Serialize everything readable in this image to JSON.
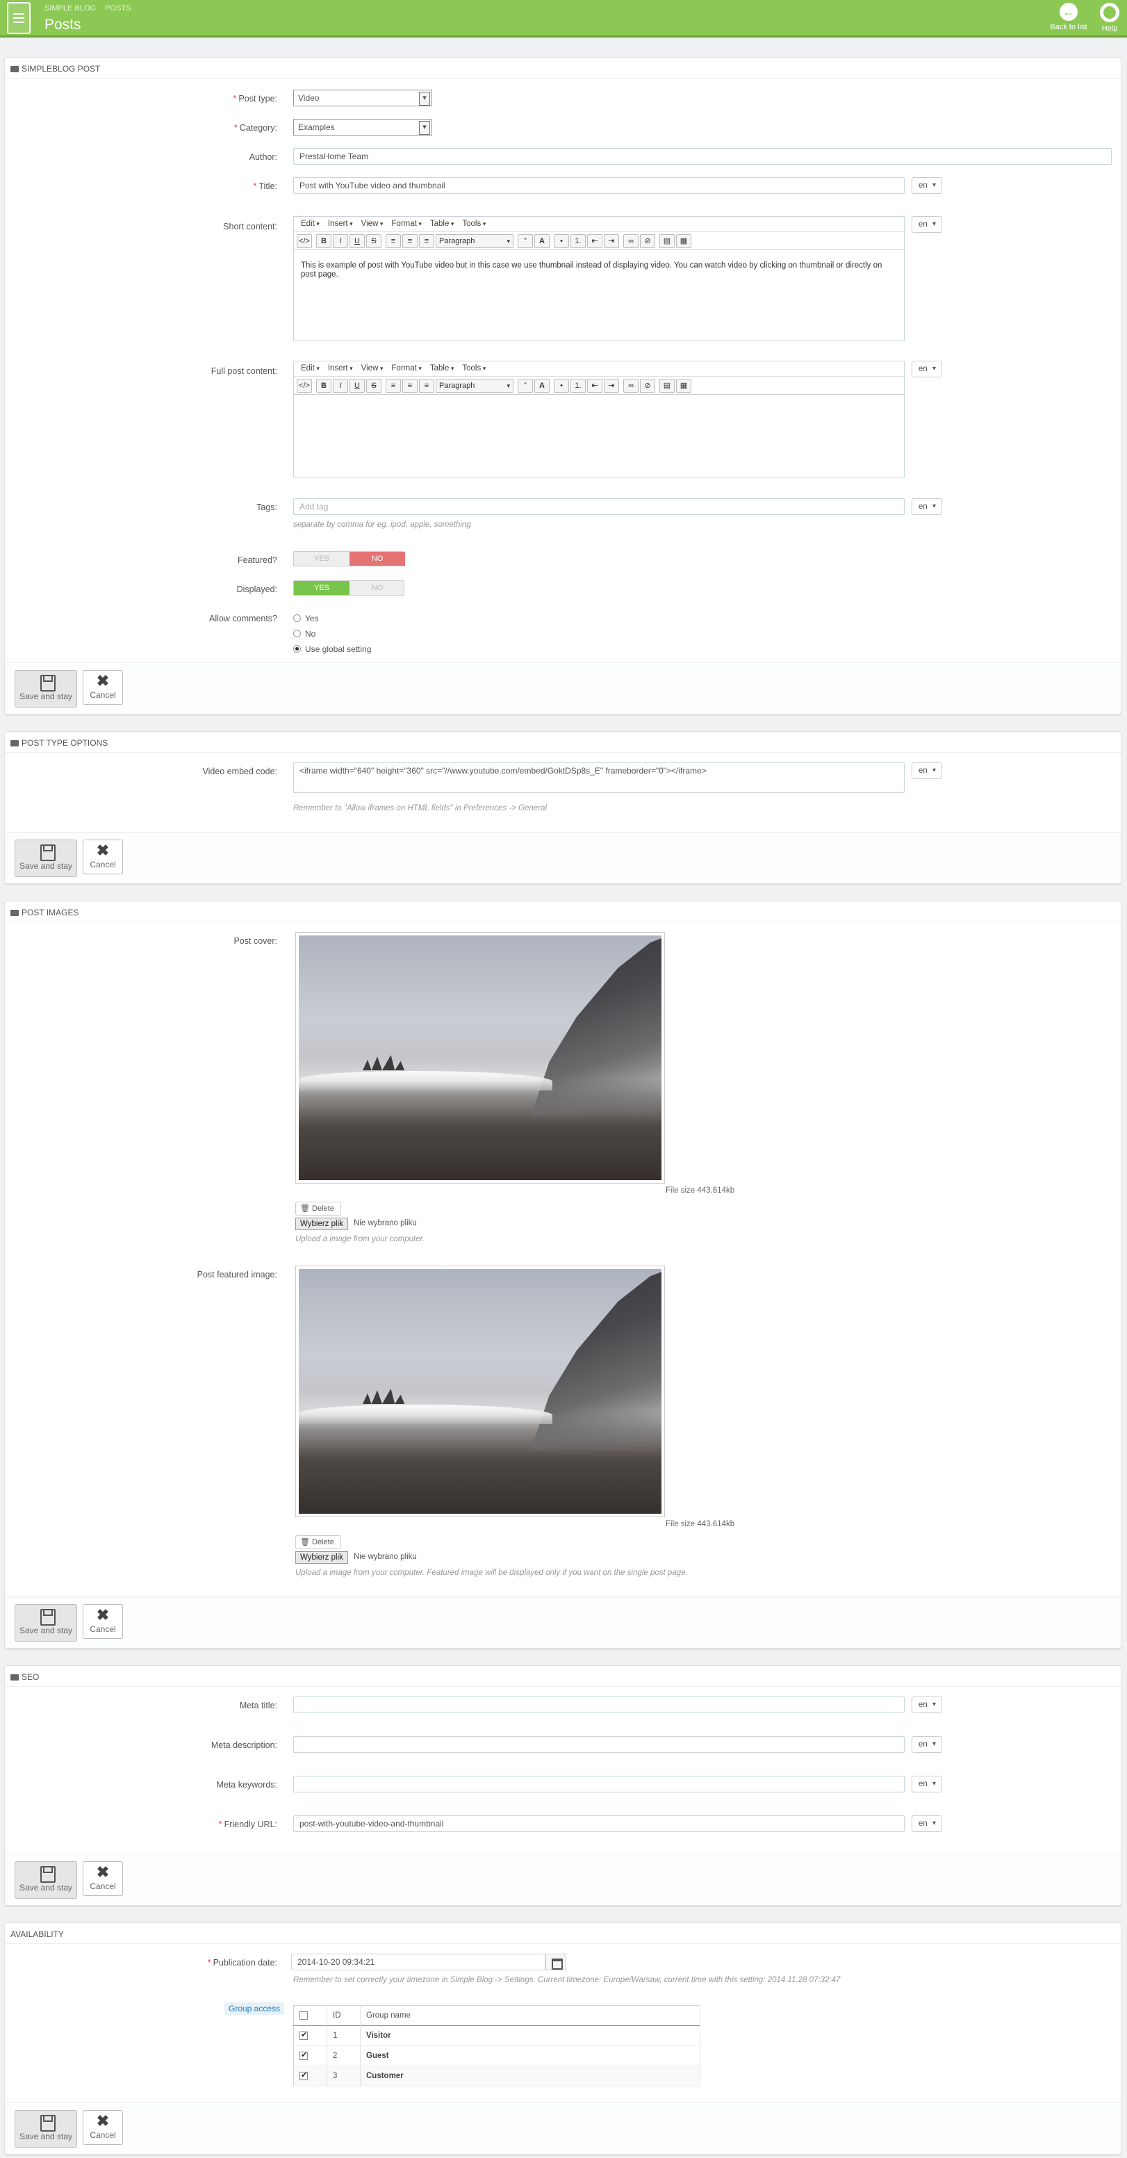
{
  "header": {
    "breadcrumb": [
      "SIMPLE BLOG",
      "POSTS"
    ],
    "title": "Posts",
    "back_label": "Back to list",
    "help_label": "Help"
  },
  "footer": {
    "save_label": "Save and stay",
    "cancel_label": "Cancel"
  },
  "post_panel": {
    "heading": "SIMPLEBLOG POST",
    "post_type": {
      "label": "Post type:",
      "value": "Video"
    },
    "category": {
      "label": "Category:",
      "value": "Examples"
    },
    "author": {
      "label": "Author:",
      "value": "PrestaHome Team"
    },
    "title": {
      "label": "Title:",
      "value": "Post with YouTube video and thumbnail",
      "lang": "en"
    },
    "editor_menu": [
      "Edit",
      "Insert",
      "View",
      "Format",
      "Table",
      "Tools"
    ],
    "editor_format": "Paragraph",
    "short_content": {
      "label": "Short content:",
      "lang": "en",
      "text": "This is example of post with YouTube video but in this case we use thumbnail instead of displaying video. You can watch video by clicking on thumbnail or directly on post page."
    },
    "full_content": {
      "label": "Full post content:",
      "lang": "en",
      "text": ""
    },
    "tags": {
      "label": "Tags:",
      "placeholder": "Add tag",
      "lang": "en",
      "hint": "separate by comma for eg. ipod, apple, something"
    },
    "featured": {
      "label": "Featured?",
      "yes": "YES",
      "no": "NO",
      "value": "no"
    },
    "displayed": {
      "label": "Displayed:",
      "yes": "YES",
      "no": "NO",
      "value": "yes"
    },
    "comments": {
      "label": "Allow comments?",
      "options": [
        "Yes",
        "No",
        "Use global setting"
      ],
      "selected": 2
    }
  },
  "type_panel": {
    "heading": "POST TYPE OPTIONS",
    "video": {
      "label": "Video embed code:",
      "value": "<iframe width=\"640\" height=\"360\" src=\"//www.youtube.com/embed/GoktDSp8s_E\" frameborder=\"0\"></iframe>",
      "lang": "en",
      "hint": "Remember to \"Allow iframes on HTML fields\" in Preferences -> General"
    }
  },
  "images_panel": {
    "heading": "POST IMAGES",
    "cover": {
      "label": "Post cover:",
      "filesize": "File size 443.614kb",
      "delete": "Delete",
      "choose": "Wybierz plik",
      "no_file": "Nie wybrano pliku",
      "hint": "Upload a image from your computer."
    },
    "featured_image": {
      "label": "Post featured image:",
      "filesize": "File size 443.614kb",
      "delete": "Delete",
      "choose": "Wybierz plik",
      "no_file": "Nie wybrano pliku",
      "hint": "Upload a image from your computer. Featured image will be displayed only if you want on the single post page."
    }
  },
  "seo_panel": {
    "heading": "SEO",
    "meta_title": {
      "label": "Meta title:",
      "value": "",
      "lang": "en"
    },
    "meta_description": {
      "label": "Meta description:",
      "value": "",
      "lang": "en"
    },
    "meta_keywords": {
      "label": "Meta keywords:",
      "value": "",
      "lang": "en"
    },
    "friendly_url": {
      "label": "Friendly URL:",
      "value": "post-with-youtube-video-and-thumbnail",
      "lang": "en"
    }
  },
  "availability_panel": {
    "heading": "AVAILABILITY",
    "publication": {
      "label": "Publication date:",
      "value": "2014-10-20 09:34:21",
      "hint": "Remember to set correctly your timezone in Simple Blog -> Settings. Current timezone: Europe/Warsaw, current time with this setting: 2014.11.28 07:32:47"
    },
    "group_access": {
      "label": "Group access",
      "columns": [
        "ID",
        "Group name"
      ],
      "rows": [
        {
          "id": "1",
          "name": "Visitor",
          "checked": true
        },
        {
          "id": "2",
          "name": "Guest",
          "checked": true
        },
        {
          "id": "3",
          "name": "Customer",
          "checked": true
        }
      ]
    }
  }
}
